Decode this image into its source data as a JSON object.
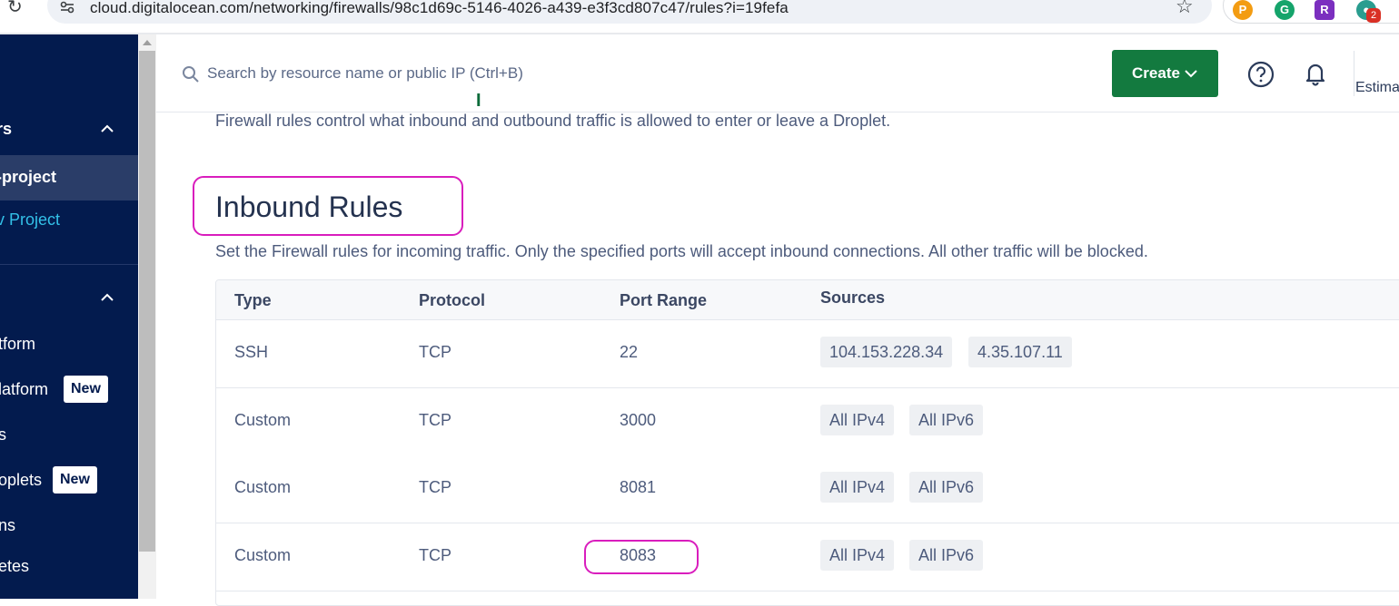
{
  "browser": {
    "url": "cloud.digitalocean.com/networking/firewalls/98c1d69c-5146-4026-a439-e3f3cd807c47/rules?i=19fefa",
    "extensions_badge": "2"
  },
  "sidebar": {
    "section1_label": "rs",
    "project_active": "-project",
    "new_project": "v Project",
    "section2_label": "",
    "items": [
      {
        "label": "tform"
      },
      {
        "label": "latform",
        "badge": "New"
      },
      {
        "label": "s"
      },
      {
        "label": "oplets",
        "badge": "New"
      },
      {
        "label": "ns"
      },
      {
        "label": "etes"
      }
    ]
  },
  "header": {
    "search_placeholder": "Search by resource name or public IP (Ctrl+B)",
    "create_label": "Create",
    "estimate_label": "Estima"
  },
  "main": {
    "intro": "Firewall rules control what inbound and outbound traffic is allowed to enter or leave a Droplet.",
    "inbound": {
      "title": "Inbound Rules",
      "description": "Set the Firewall rules for incoming traffic. Only the specified ports will accept inbound connections. All other traffic will be blocked.",
      "columns": [
        "Type",
        "Protocol",
        "Port Range",
        "Sources"
      ],
      "rows": [
        {
          "type": "SSH",
          "protocol": "TCP",
          "port": "22",
          "sources": [
            "104.153.228.34",
            "4.35.107.11"
          ]
        },
        {
          "type": "Custom",
          "protocol": "TCP",
          "port": "3000",
          "sources": [
            "All IPv4",
            "All IPv6"
          ]
        },
        {
          "type": "Custom",
          "protocol": "TCP",
          "port": "8081",
          "sources": [
            "All IPv4",
            "All IPv6"
          ]
        },
        {
          "type": "Custom",
          "protocol": "TCP",
          "port": "8083",
          "sources": [
            "All IPv4",
            "All IPv6"
          ]
        }
      ]
    }
  },
  "colors": {
    "sidebar_bg": "#031b4e",
    "create_green": "#137a3f",
    "highlight_magenta": "#d91dbd",
    "link_cyan": "#33c1e8"
  }
}
